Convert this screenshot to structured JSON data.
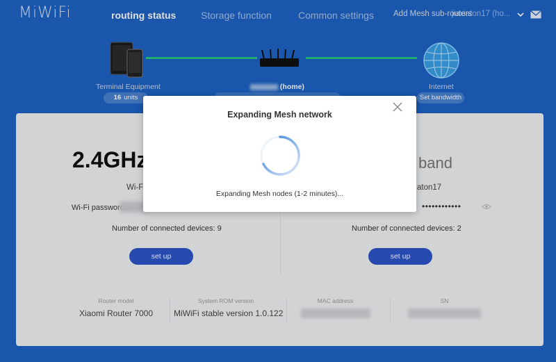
{
  "header": {
    "logo": "MiWiFi",
    "nav": [
      "routing status",
      "Storage function",
      "Common settings"
    ],
    "mesh_link": "Add Mesh sub-routers",
    "user": "jiaxiaton17 (ho...",
    "icons": [
      "chevron-down-icon",
      "mail-icon"
    ]
  },
  "topology": {
    "terminal": {
      "label": "Terminal Equipment",
      "count": "16",
      "unit": "units"
    },
    "router": {
      "name_suffix": "(home)"
    },
    "internet": {
      "label": "Internet",
      "action": "Set bandwidth"
    },
    "link_color": "#28c47c"
  },
  "bands": {
    "left": {
      "title": "2.4GHz",
      "wifi_label": "Wi-Fi",
      "password_label": "Wi-Fi password:",
      "connected": "Number of connected devices: 9",
      "setup": "set up"
    },
    "right": {
      "title": "band",
      "ssid_partial": "aton17",
      "password_mask": "••••••••••••",
      "connected": "Number of connected devices: 2",
      "setup": "set up"
    }
  },
  "info": [
    {
      "label": "Router model",
      "value": "Xiaomi Router 7000"
    },
    {
      "label": "System ROM version",
      "value": "MiWiFi stable version 1.0.122"
    },
    {
      "label": "MAC address",
      "value": ""
    },
    {
      "label": "SN",
      "value": ""
    }
  ],
  "modal": {
    "title": "Expanding Mesh network",
    "message": "Expanding Mesh nodes (1-2 minutes)...",
    "icons": [
      "close-icon",
      "loading-spinner-icon"
    ]
  },
  "colors": {
    "background": "#1d62c4",
    "accent_button": "#2c55c9",
    "spinner": "#2f7ad9"
  }
}
